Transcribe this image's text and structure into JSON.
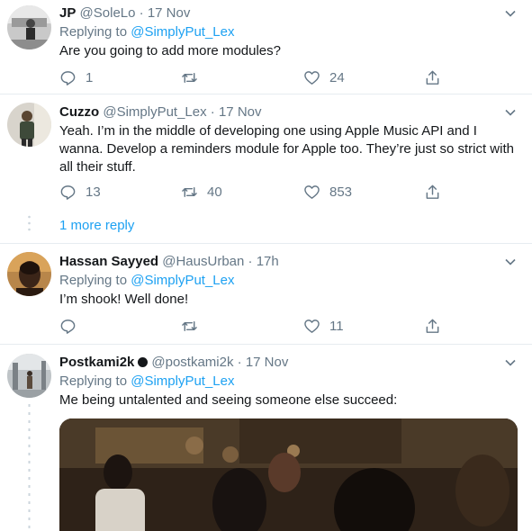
{
  "tweets": [
    {
      "name": "JP",
      "handle": "@SoleLo",
      "dot": "·",
      "time": "17 Nov",
      "replying_prefix": "Replying to",
      "replying_to": "@SimplyPut_Lex",
      "text": "Are you going to add more modules?",
      "replies": "1",
      "retweets": "",
      "likes": "24"
    },
    {
      "name": "Cuzzo",
      "handle": "@SimplyPut_Lex",
      "dot": "·",
      "time": "17 Nov",
      "text": "Yeah. I’m in the middle of developing one using Apple Music API and I wanna. Develop a reminders module for Apple too. They’re just so strict with all their stuff.",
      "replies": "13",
      "retweets": "40",
      "likes": "853"
    },
    {
      "name": "Hassan Sayyed",
      "handle": "@HausUrban",
      "dot": "·",
      "time": "17h",
      "replying_prefix": "Replying to",
      "replying_to": "@SimplyPut_Lex",
      "text": "I’m shook! Well done!",
      "replies": "",
      "retweets": "",
      "likes": "11"
    },
    {
      "name": "Postkami2k",
      "handle": "@postkami2k",
      "dot": "·",
      "time": "17 Nov",
      "replying_prefix": "Replying to",
      "replying_to": "@SimplyPut_Lex",
      "text": "Me being untalented and seeing someone else succeed:"
    }
  ],
  "more_replies_label": "1 more reply",
  "icons": [
    "caret-down-icon",
    "reply-icon",
    "retweet-icon",
    "like-icon",
    "share-icon",
    "verified-badge-icon"
  ],
  "colors": {
    "link": "#1da1f2",
    "secondary": "#657786",
    "border": "#e6ecf0"
  }
}
